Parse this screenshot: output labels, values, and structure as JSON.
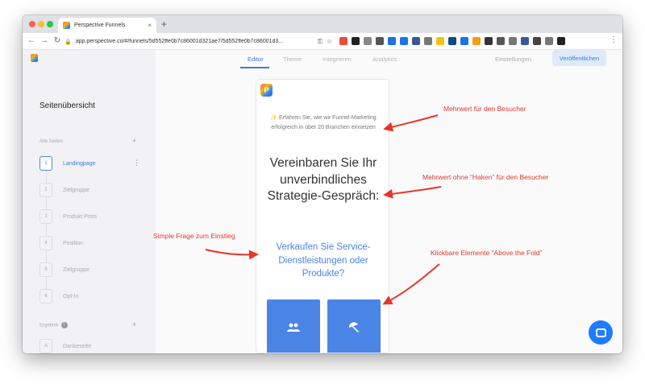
{
  "browser": {
    "tab_title": "Perspective Funnels",
    "tab_close": "×",
    "new_tab": "+",
    "url": "app.perspective.co/#/funnels/5d552ffe0b7c86001d321ae7/5d552ffe0b7c86001d3...",
    "nav": {
      "back": "←",
      "forward": "→",
      "reload": "↻"
    },
    "lock": "🔒",
    "key_icon": "⚿",
    "star_icon": "☆",
    "menu": "⋮",
    "extension_colors": [
      "#e74c3c",
      "#222222",
      "#888888",
      "#555555",
      "#1a73e8",
      "#1a73e8",
      "#3b5998",
      "#777777",
      "#f1c40f",
      "#0f4c81",
      "#1a73e8",
      "#f39c12",
      "#333333",
      "#555555",
      "#777777",
      "#3b5998",
      "#444444",
      "#777777",
      "#222222"
    ]
  },
  "app": {
    "topnav": [
      "Editor",
      "Theme",
      "Integrieren",
      "Analytics"
    ],
    "settings_label": "Einstellungen",
    "publish_label": "Veröffentlichen",
    "sidebar": {
      "title": "Seitenübersicht",
      "all_pages_label": "Alle Seiten",
      "add": "+",
      "steps": [
        {
          "num": "1",
          "label": "Landingpage",
          "active": true
        },
        {
          "num": "2",
          "label": "Zielgruppe",
          "active": false
        },
        {
          "num": "3",
          "label": "Produkt Preis",
          "active": false
        },
        {
          "num": "4",
          "label": "Position",
          "active": false
        },
        {
          "num": "5",
          "label": "Zielgruppe",
          "active": false
        },
        {
          "num": "6",
          "label": "Opt-In",
          "active": false
        }
      ],
      "kebab": "⋮",
      "result_label": "Ergebnis",
      "info": "i",
      "result_steps": [
        {
          "num": "A",
          "label": "Dankeseite"
        }
      ]
    },
    "card": {
      "logo_letter": "P",
      "subtitle": "✨ Erfahren Sie, wie wir Funnel-Marketing erfolgreich in über 20 Branchen einsetzen",
      "title": "Vereinbaren Sie Ihr unverbindliches Strategie-Gespräch:",
      "question": "Verkaufen Sie Service-Dienstleistungen oder Produkte?",
      "answer_icons": [
        "people-icon",
        "umbrella-icon"
      ]
    }
  },
  "annotations": [
    {
      "text": "Mehrwert für den Besucher"
    },
    {
      "text": "Mehrwert ohne “Haken” für den Besucher"
    },
    {
      "text": "Simple Frage zum Einstieg"
    },
    {
      "text": "Klickbare Elemente “Above the Fold”"
    }
  ],
  "colors": {
    "accent": "#4a85e6",
    "annotation": "#e8352b",
    "chat": "#1f7bff"
  }
}
